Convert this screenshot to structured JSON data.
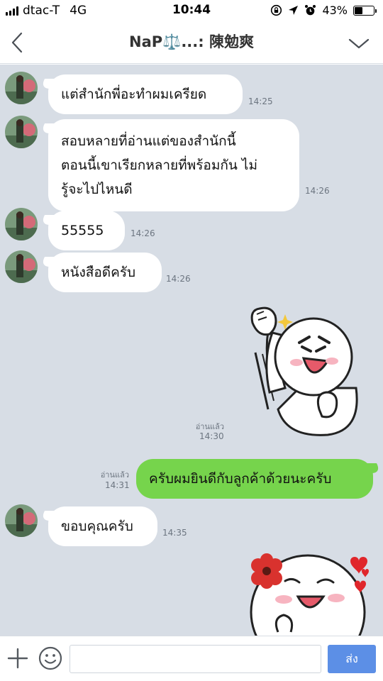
{
  "status_bar": {
    "carrier": "dtac-T",
    "network": "4G",
    "time": "10:44",
    "battery_percent": "43%",
    "battery_level": 0.43
  },
  "header": {
    "title": "NaP⚖️...: 陳勉爽",
    "back_icon": "chevron-left-icon",
    "dropdown_icon": "chevron-down-icon"
  },
  "messages": [
    {
      "sender": "other",
      "text": "แต่สำนักพี่อะทำผมเครียด",
      "time": "14:25"
    },
    {
      "sender": "other",
      "lines": [
        "สอบหลายที่อ่านแต่ของสำนักนี้",
        "ตอนนี้เขาเรียกหลายที่พร้อมกัน ไม่",
        "รู้จะไปไหนดี"
      ],
      "time": "14:26"
    },
    {
      "sender": "other",
      "text": "55555",
      "time": "14:26"
    },
    {
      "sender": "other",
      "text": "หนังสือดีครับ",
      "time": "14:26"
    },
    {
      "sender": "me",
      "sticker": "cheering-moon-sticker",
      "read": "อ่านแล้ว",
      "time": "14:30"
    },
    {
      "sender": "me",
      "text": "ครับผมยินดีกับลูกค้าด้วยนะครับ",
      "read": "อ่านแล้ว",
      "time": "14:31"
    },
    {
      "sender": "other",
      "text": "ขอบคุณครับ",
      "time": "14:35"
    },
    {
      "sender": "me",
      "sticker": "happy-moon-flower-sticker"
    }
  ],
  "input": {
    "placeholder": "",
    "value": "",
    "send_label": "ส่ง",
    "plus_icon": "plus-icon",
    "emoji_icon": "emoji-icon"
  },
  "colors": {
    "chat_background": "#d7dde5",
    "my_bubble": "#76d44c",
    "other_bubble": "#ffffff",
    "send_button": "#5c8fe6"
  }
}
